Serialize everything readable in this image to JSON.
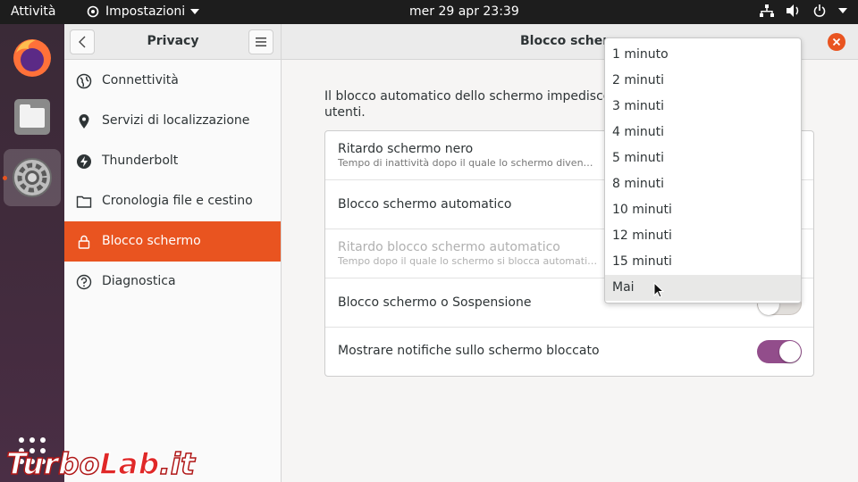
{
  "topbar": {
    "activities": "Attività",
    "app_menu": "Impostazioni",
    "clock": "mer 29 apr  23:39"
  },
  "sidebar": {
    "title": "Privacy",
    "items": [
      {
        "label": "Connettività",
        "icon": "globe-icon"
      },
      {
        "label": "Servizi di localizzazione",
        "icon": "location-pin-icon"
      },
      {
        "label": "Thunderbolt",
        "icon": "thunderbolt-icon"
      },
      {
        "label": "Cronologia file e cestino",
        "icon": "folder-icon"
      },
      {
        "label": "Blocco schermo",
        "icon": "lock-icon",
        "selected": true
      },
      {
        "label": "Diagnostica",
        "icon": "help-icon"
      }
    ]
  },
  "main": {
    "title": "Blocco scherm",
    "description": "Il blocco automatico dello schermo impedisce l utenti.",
    "description_line1": "Il blocco automatico dello schermo impedisce l",
    "description_line2": "utenti.",
    "rows": [
      {
        "title": "Ritardo schermo nero",
        "subtitle": "Tempo di inattività dopo il quale lo schermo diven…"
      },
      {
        "title": "Blocco schermo automatico"
      },
      {
        "title": "Ritardo blocco schermo automatico",
        "subtitle": "Tempo dopo il quale lo schermo si blocca automati…",
        "disabled": true
      },
      {
        "title": "Blocco schermo o Sospensione",
        "toggle": "off"
      },
      {
        "title": "Mostrare notifiche sullo schermo bloccato",
        "toggle": "on"
      }
    ]
  },
  "dropdown": {
    "options": [
      "1 minuto",
      "2 minuti",
      "3 minuti",
      "4 minuti",
      "5 minuti",
      "8 minuti",
      "10 minuti",
      "12 minuti",
      "15 minuti",
      "Mai"
    ],
    "hovered": "Mai"
  },
  "watermark": "TurboLab.it",
  "colors": {
    "accent": "#e95420",
    "toggle_on": "#924d8b",
    "topbar": "#1d1d1d"
  }
}
